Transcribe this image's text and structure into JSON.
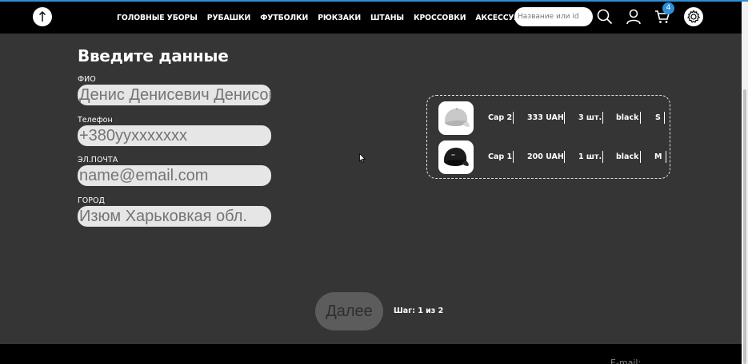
{
  "header": {
    "up_icon": "arrow-up-icon",
    "nav": [
      "ГОЛОВНЫЕ УБОРЫ",
      "РУБАШКИ",
      "ФУТБОЛКИ",
      "РЮКЗАКИ",
      "ШТАНЫ",
      "КРОССОВКИ",
      "АКСЕССУАРЫ"
    ],
    "search_placeholder": "Название или id",
    "cart_count": "4",
    "accent_color": "#2f8fd8"
  },
  "form": {
    "title": "Введите данные",
    "fields": [
      {
        "label": "ФИО",
        "placeholder": "Денис Денисевич Денисов"
      },
      {
        "label": "Телефон",
        "placeholder": "+380yyxxxxxxx"
      },
      {
        "label": "ЭЛ.ПОЧТА",
        "placeholder": "name@email.com"
      },
      {
        "label": "ГОРОД",
        "placeholder": "Изюм Харьковкая обл."
      }
    ]
  },
  "cart": {
    "items": [
      {
        "name": "Cap 2",
        "price": "333 UAH",
        "qty": "3 шт.",
        "color": "black",
        "size": "S",
        "image": "gray-cap"
      },
      {
        "name": "Cap 1",
        "price": "200 UAH",
        "qty": "1 шт.",
        "color": "black",
        "size": "M",
        "image": "black-cap"
      }
    ]
  },
  "next_label": "Далее",
  "step_text": "Шаг: 1 из 2",
  "footer": {
    "email_label": "E-mail:"
  }
}
